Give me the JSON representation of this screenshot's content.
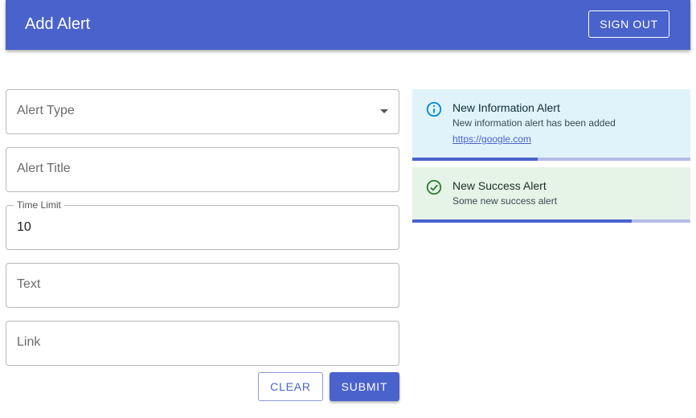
{
  "header": {
    "title": "Add Alert",
    "signout_label": "SIGN OUT"
  },
  "form": {
    "alert_type": {
      "placeholder": "Alert Type",
      "value": ""
    },
    "alert_title": {
      "placeholder": "Alert Title",
      "value": ""
    },
    "time_limit": {
      "label": "Time Limit",
      "value": "10"
    },
    "text": {
      "placeholder": "Text",
      "value": ""
    },
    "link": {
      "placeholder": "Link",
      "value": ""
    },
    "clear_label": "CLEAR",
    "submit_label": "SUBMIT"
  },
  "alerts": [
    {
      "type": "info",
      "icon": "info-icon",
      "title": "New Information Alert",
      "message": "New information alert has been added",
      "link": "https://google.com",
      "progress_fraction": 0.45,
      "color": "#0288d1"
    },
    {
      "type": "success",
      "icon": "check-circle-icon",
      "title": "New Success Alert",
      "message": "Some new success alert",
      "progress_fraction": 0.79,
      "color": "#2e7d32"
    }
  ],
  "colors": {
    "primary": "#4a62cc",
    "info_bg": "#e0f3fa",
    "success_bg": "#e6f4e8"
  }
}
